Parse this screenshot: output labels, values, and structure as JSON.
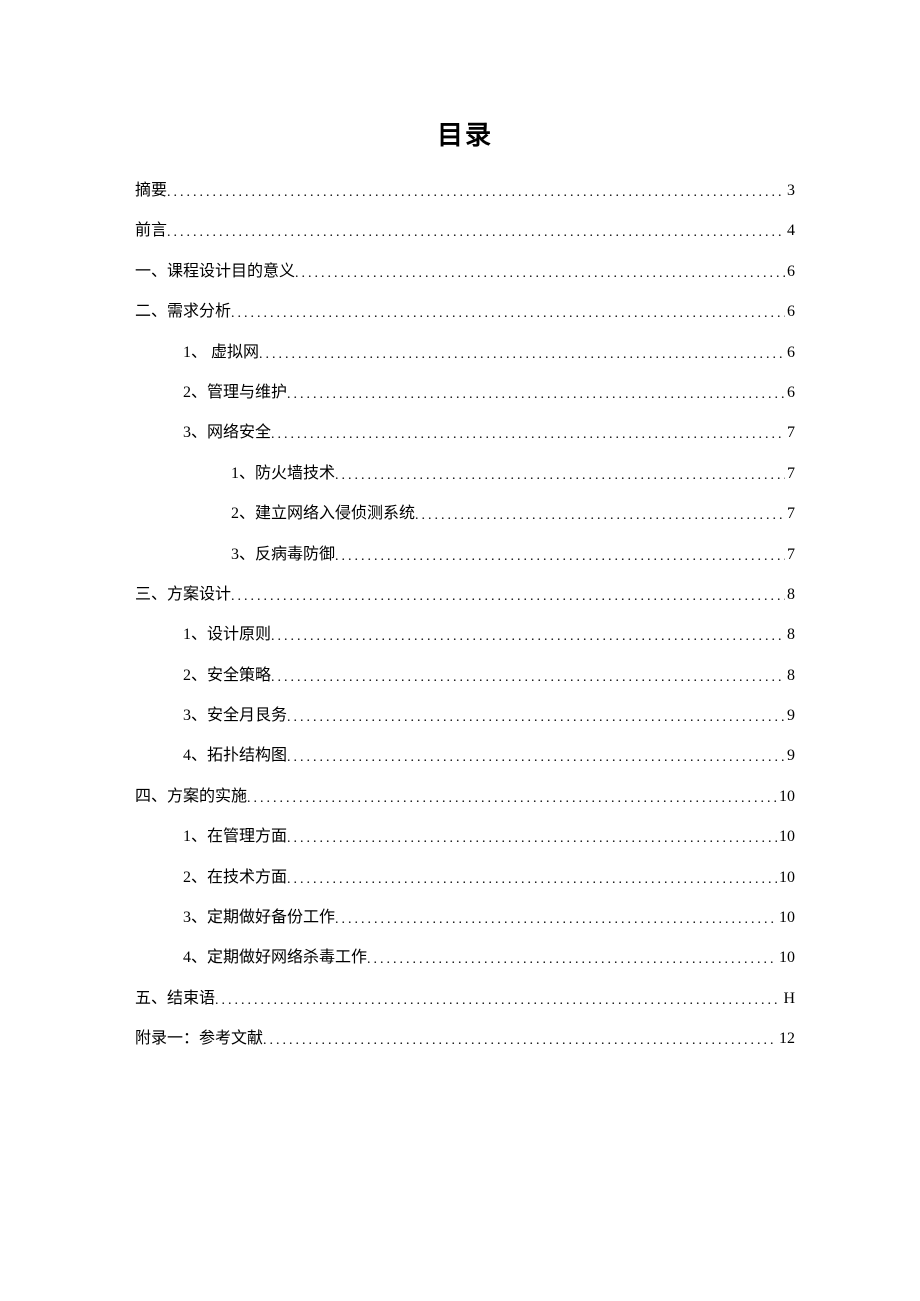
{
  "title": "目录",
  "entries": [
    {
      "label": "摘要",
      "page": "3",
      "indent": 0
    },
    {
      "label": "前言",
      "page": "4",
      "indent": 0
    },
    {
      "label": "一、课程设计目的意义",
      "page": "6",
      "indent": 0
    },
    {
      "label": "二、需求分析",
      "page": "6",
      "indent": 0
    },
    {
      "label": "1、 虚拟网",
      "page": "6",
      "indent": 1
    },
    {
      "label": "2、管理与维护",
      "page": "6",
      "indent": 1
    },
    {
      "label": "3、网络安全",
      "page": "7",
      "indent": 1
    },
    {
      "label": "1、防火墙技术",
      "page": "7",
      "indent": 2
    },
    {
      "label": "2、建立网络入侵侦测系统",
      "page": "7",
      "indent": 2
    },
    {
      "label": "3、反病毒防御",
      "page": "7",
      "indent": 2
    },
    {
      "label": "三、方案设计",
      "page": "8",
      "indent": 0
    },
    {
      "label": "1、设计原则",
      "page": "8",
      "indent": 1
    },
    {
      "label": "2、安全策略",
      "page": "8",
      "indent": 1
    },
    {
      "label": "3、安全月艮务",
      "page": "9",
      "indent": 1
    },
    {
      "label": "4、拓扑结构图",
      "page": "9",
      "indent": 1
    },
    {
      "label": "四、方案的实施 ",
      "page": "10",
      "indent": 0
    },
    {
      "label": "1、在管理方面",
      "page": "10",
      "indent": 1
    },
    {
      "label": "2、在技术方面",
      "page": "10",
      "indent": 1
    },
    {
      "label": "3、定期做好备份工作",
      "page": "10",
      "indent": 1
    },
    {
      "label": "4、定期做好网络杀毒工作",
      "page": "10",
      "indent": 1
    },
    {
      "label": "五、结束语",
      "page": "H",
      "indent": 0
    },
    {
      "label": "附录一：参考文献 ",
      "page": "12",
      "indent": 0
    }
  ]
}
